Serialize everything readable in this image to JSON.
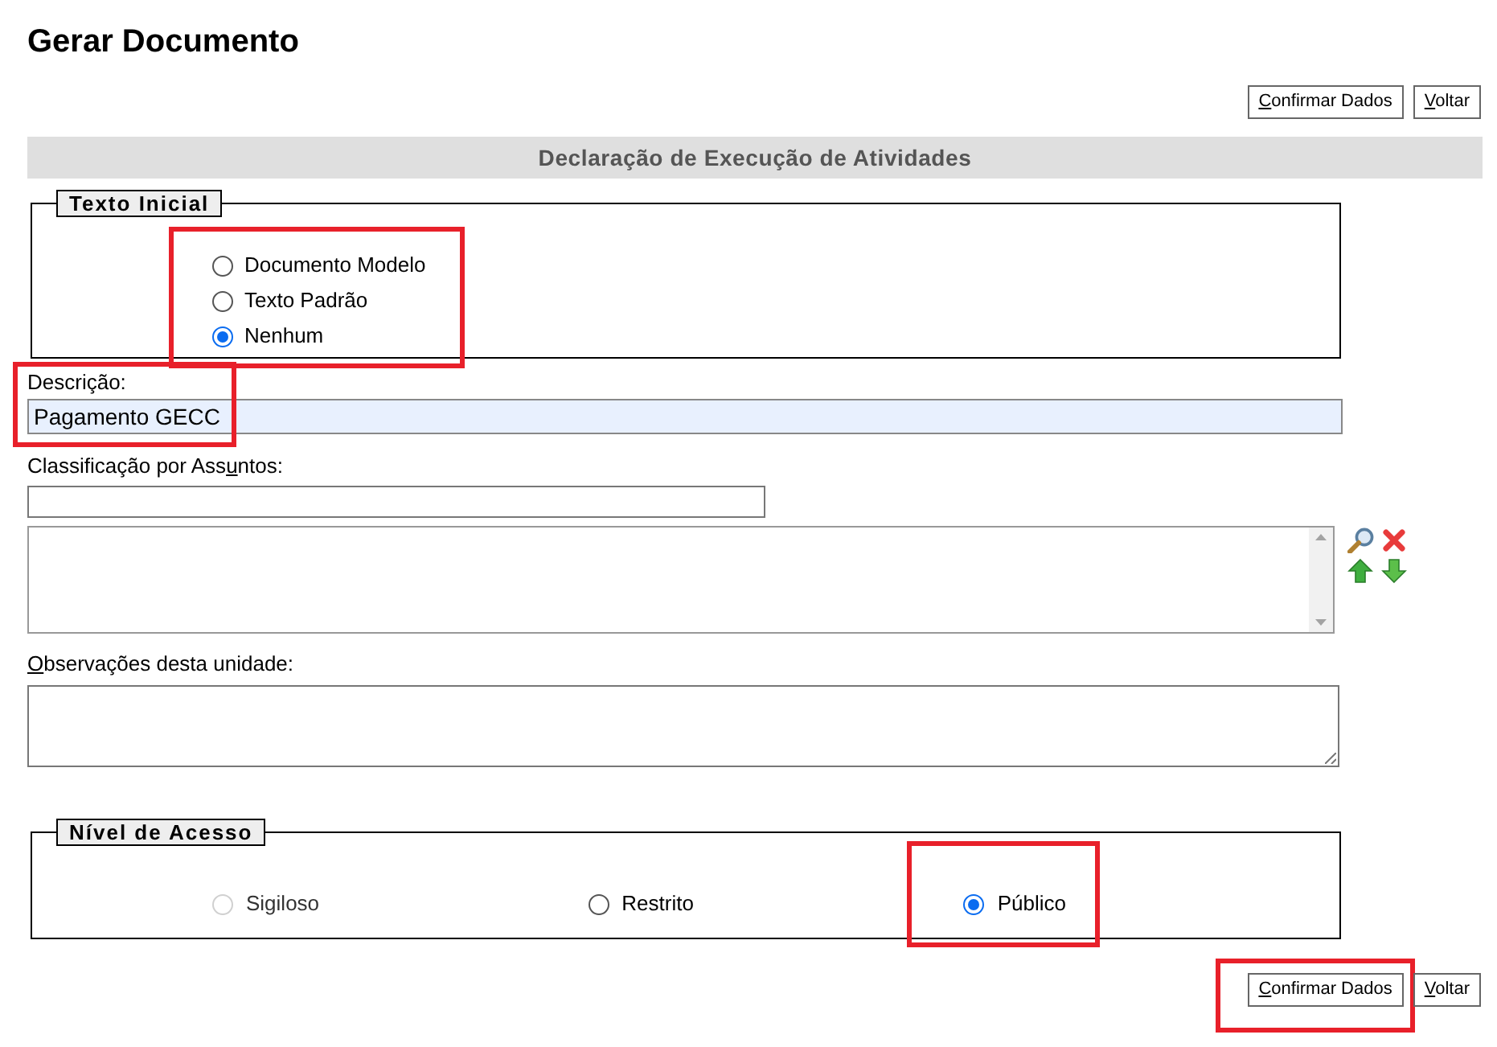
{
  "title": "Gerar Documento",
  "top_buttons": [
    {
      "key": "C",
      "post": "onfirmar Dados",
      "highlighted": false
    },
    {
      "key": "V",
      "post": "oltar",
      "highlighted": false
    }
  ],
  "document_type": "Declaração de Execução de Atividades",
  "initial_text": {
    "legend": "Texto Inicial",
    "highlighted": true,
    "options": [
      {
        "label": "Documento Modelo",
        "selected": false
      },
      {
        "label": "Texto Padrão",
        "selected": false
      },
      {
        "label": "Nenhum",
        "selected": true
      }
    ]
  },
  "description": {
    "label": "Descrição:",
    "value": "Pagamento GECC",
    "highlighted": true
  },
  "subjects": {
    "label": {
      "pre": "Classificação por Ass",
      "key": "u",
      "post": "ntos:"
    }
  },
  "notes": {
    "label": {
      "key": "O",
      "post": "bservações desta unidade:"
    }
  },
  "access_level": {
    "legend": "Nível de Acesso",
    "options": [
      {
        "label": "Sigiloso",
        "selected": false,
        "disabled": true,
        "highlighted": false
      },
      {
        "label": "Restrito",
        "selected": false,
        "disabled": false,
        "highlighted": false
      },
      {
        "label": "Público",
        "selected": true,
        "disabled": false,
        "highlighted": true
      }
    ]
  },
  "bottom_buttons": [
    {
      "key": "C",
      "post": "onfirmar Dados",
      "highlighted": true
    },
    {
      "key": "V",
      "post": "oltar",
      "highlighted": false
    }
  ]
}
